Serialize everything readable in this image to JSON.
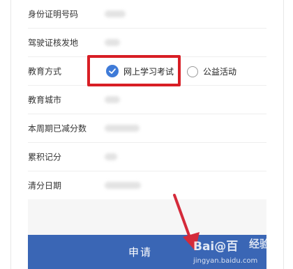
{
  "form": {
    "rows": [
      {
        "label": "身份证明号码"
      },
      {
        "label": "驾驶证核发地"
      },
      {
        "label": "教育方式"
      },
      {
        "label": "教育城市"
      },
      {
        "label": "本周期已减分数"
      },
      {
        "label": "累积记分"
      },
      {
        "label": "清分日期"
      }
    ],
    "education_options": {
      "online": {
        "label": "网上学习考试",
        "selected": true
      },
      "public": {
        "label": "公益活动",
        "selected": false
      }
    }
  },
  "submit": {
    "label": "申请"
  },
  "watermark": {
    "logo": "Bai@百",
    "brand": "经验",
    "url": "jingyan.baidu.com"
  },
  "colors": {
    "highlight": "#d81e25",
    "primary": "#3a66b5",
    "radio_selected": "#3f7bd8",
    "arrow": "#d42a3a"
  }
}
